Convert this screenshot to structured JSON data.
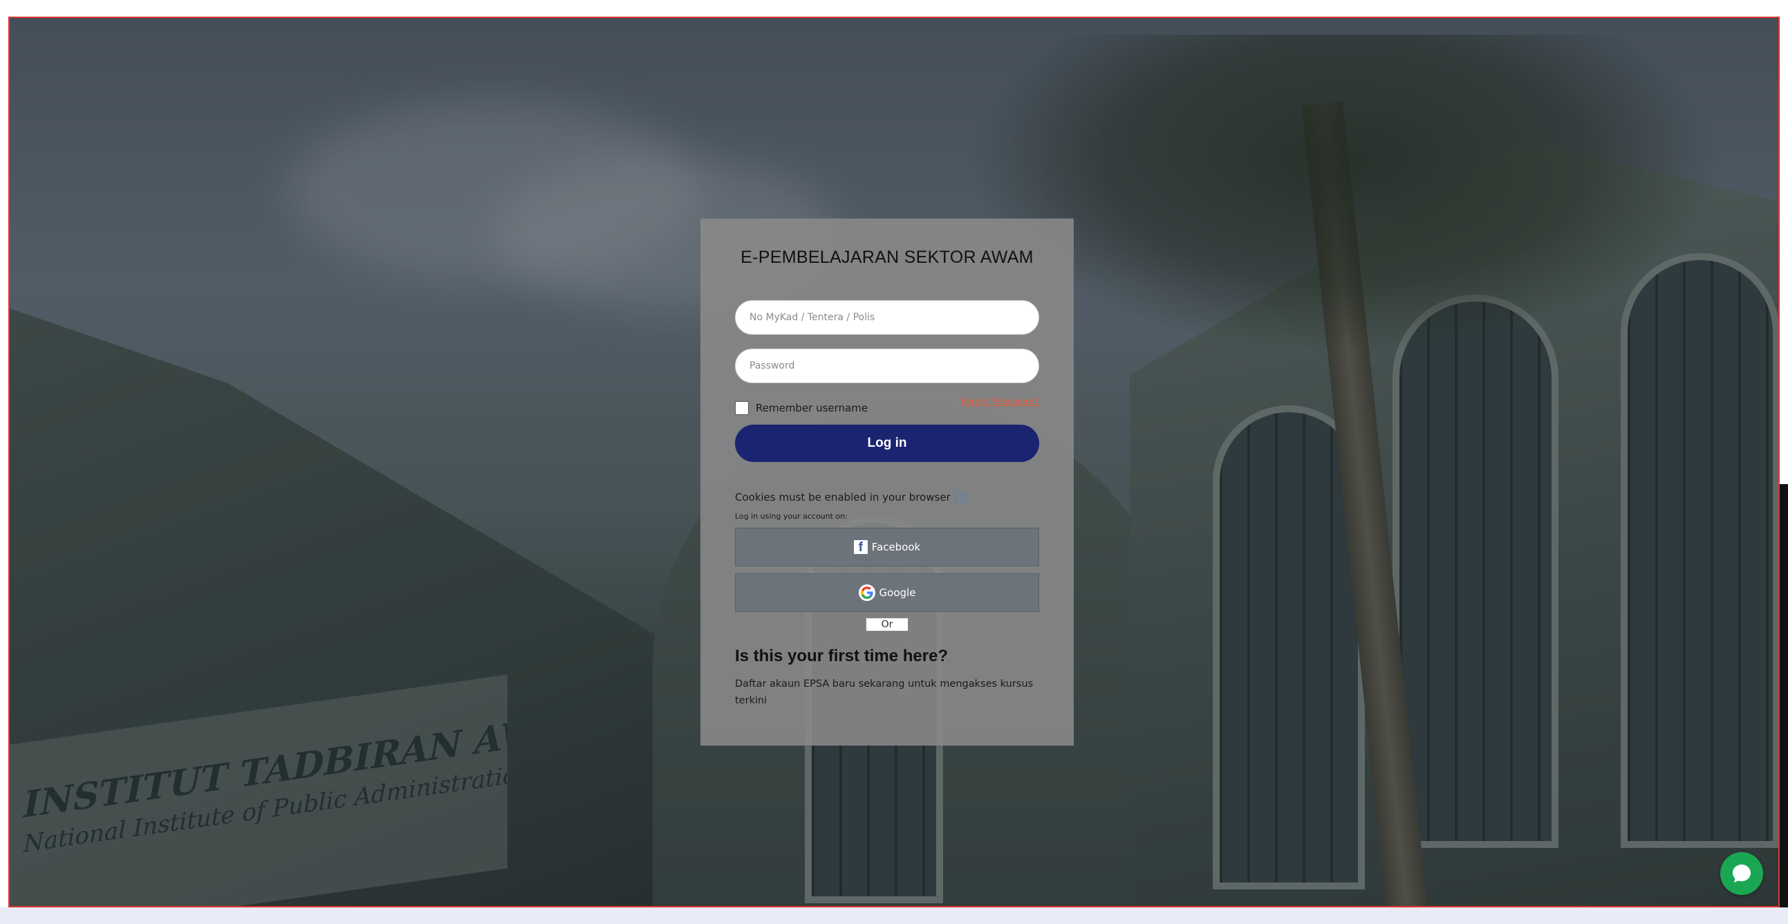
{
  "login": {
    "title": "E-PEMBELAJARAN SEKTOR AWAM",
    "username_placeholder": "No MyKad / Tentera / Polis",
    "username_value": "",
    "password_placeholder": "Password",
    "password_value": "",
    "remember_label": "Remember username",
    "remember_checked": false,
    "forgot_label": "Forgot Password?",
    "login_button": "Log in",
    "cookies_notice": "Cookies must be enabled in your browser",
    "help_icon": "?",
    "login_using": "Log in using your account on:",
    "facebook_label": "Facebook",
    "google_label": "Google",
    "or_label": "Or",
    "first_time_heading": "Is this your first time here?",
    "first_time_desc": "Daftar akaun EPSA baru sekarang untuk mengakses kursus terkini"
  },
  "background": {
    "sign_line1": "INSTITUT TADBIRAN AWAM NEGARA (INTAN)",
    "sign_line2": "National Institute of Public Administration"
  },
  "icons": {
    "facebook": "facebook-icon",
    "google": "google-icon",
    "help": "help-icon",
    "chat": "chat-icon"
  },
  "colors": {
    "login_button": "#1b2470",
    "forgot_link": "#e45a3c",
    "chat_bubble": "#1aa753",
    "frame_border": "#e2342c"
  }
}
